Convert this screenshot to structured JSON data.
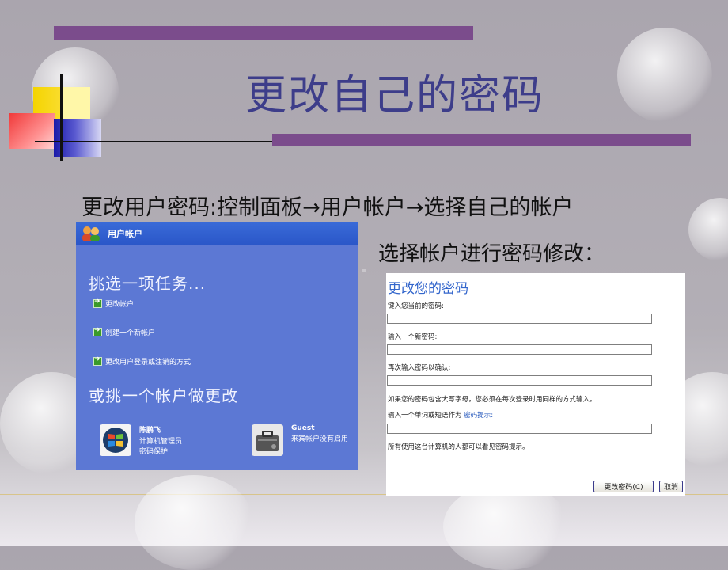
{
  "slide": {
    "title": "更改自己的密码",
    "subtitle": "更改用户密码:控制面板→用户帐户→选择自己的帐户",
    "subtitle2": "选择帐户进行密码修改："
  },
  "accounts_panel": {
    "header": "用户帐户",
    "pick_task": "挑选一项任务...",
    "tasks": [
      "更改帐户",
      "创建一个新帐户",
      "更改用户登录或注销的方式"
    ],
    "pick_account": "或挑一个帐户做更改",
    "accounts": [
      {
        "name": "陈鹏飞",
        "line1": "计算机管理员",
        "line2": "密码保护",
        "icon": "windows-logo-icon"
      },
      {
        "name": "Guest",
        "line1": "来宾帐户没有启用",
        "line2": "",
        "icon": "briefcase-icon"
      }
    ]
  },
  "password_form": {
    "title": "更改您的密码",
    "current_label": "键入您当前的密码:",
    "current_value": "",
    "new_label": "输入一个新密码:",
    "new_value": "",
    "confirm_label": "再次输入密码以确认:",
    "confirm_value": "",
    "uppercase_note": "如果您的密码包含大写字母，您必须在每次登录时用同样的方式输入。",
    "hint_label": "输入一个单词或短语作为",
    "hint_link": "密码提示:",
    "hint_value": "",
    "visibility_note": "所有使用这台计算机的人都可以看见密码提示。",
    "change_button": "更改密码(C)",
    "cancel_button": "取消"
  },
  "colors": {
    "title": "#3d3d8a",
    "purple_bar": "#7b4c8c",
    "xp_panel": "#5c78d4",
    "form_title": "#3366cc"
  }
}
